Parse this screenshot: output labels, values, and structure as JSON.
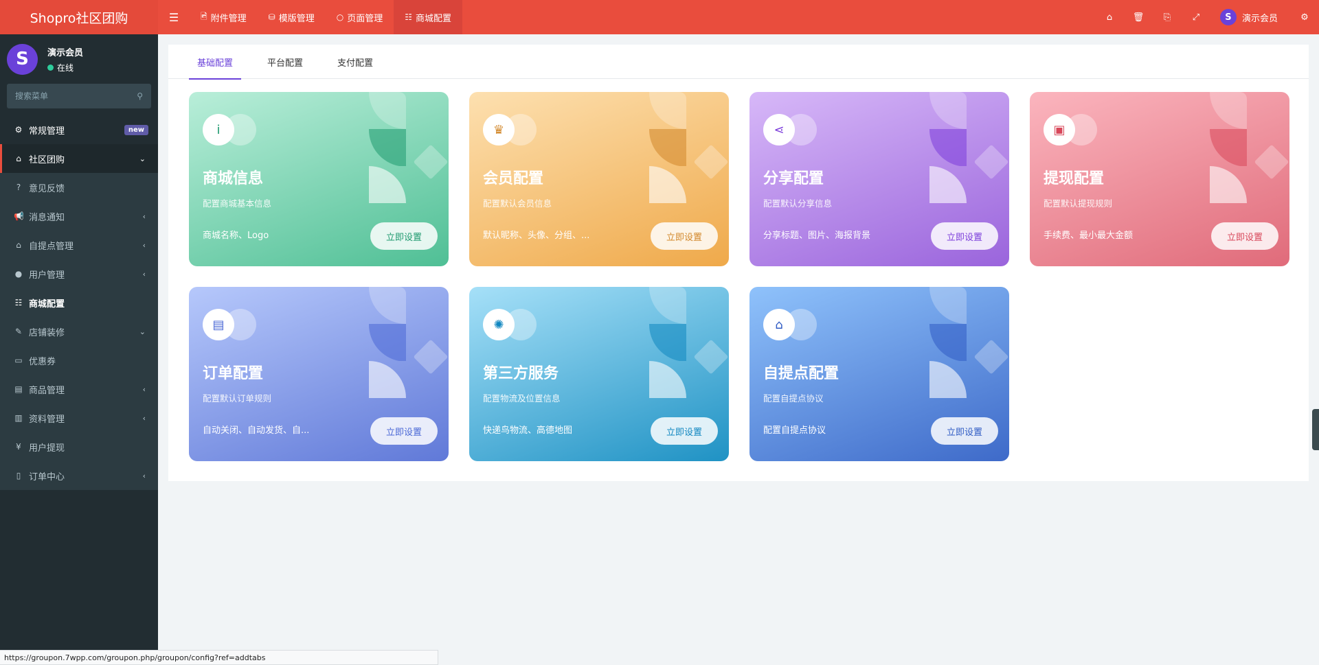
{
  "header": {
    "logo": "Shopro社区团购",
    "tabs": [
      {
        "label": "附件管理",
        "icon": "file-image-icon"
      },
      {
        "label": "模版管理",
        "icon": "cubes-icon"
      },
      {
        "label": "页面管理",
        "icon": "circle-icon"
      },
      {
        "label": "商城配置",
        "icon": "sliders-icon"
      }
    ],
    "right_icons": [
      "home-icon",
      "trash-icon",
      "translate-icon",
      "fullscreen-icon"
    ],
    "user_name": "演示会员",
    "user_avatar": "S"
  },
  "sidebar": {
    "user": {
      "name": "演示会员",
      "status": "在线",
      "avatar": "S"
    },
    "search_placeholder": "搜索菜单",
    "items": [
      {
        "label": "常规管理",
        "badge": "new"
      },
      {
        "label": "社区团购"
      },
      {
        "label": "意见反馈"
      },
      {
        "label": "消息通知"
      },
      {
        "label": "自提点管理"
      },
      {
        "label": "用户管理"
      },
      {
        "label": "商城配置"
      },
      {
        "label": "店铺装修"
      },
      {
        "label": "优惠券"
      },
      {
        "label": "商品管理"
      },
      {
        "label": "资料管理"
      },
      {
        "label": "用户提现"
      },
      {
        "label": "订单中心"
      }
    ]
  },
  "config": {
    "tabs": [
      "基础配置",
      "平台配置",
      "支付配置"
    ],
    "cards": [
      {
        "title": "商城信息",
        "subtitle": "配置商城基本信息",
        "desc": "商城名称、Logo",
        "button": "立即设置",
        "icon": "info-icon",
        "color_from": "#b9eed9",
        "color_to": "#4fbf95",
        "accent": "#1f9a6f"
      },
      {
        "title": "会员配置",
        "subtitle": "配置默认会员信息",
        "desc": "默认昵称、头像、分组、...",
        "button": "立即设置",
        "icon": "crown-icon",
        "color_from": "#fde0b0",
        "color_to": "#efa94a",
        "accent": "#d2872a"
      },
      {
        "title": "分享配置",
        "subtitle": "配置默认分享信息",
        "desc": "分享标题、图片、海报背景",
        "button": "立即设置",
        "icon": "share-icon",
        "color_from": "#d7b8f8",
        "color_to": "#9a64dc",
        "accent": "#7c3ddb"
      },
      {
        "title": "提现配置",
        "subtitle": "配置默认提现规则",
        "desc": "手续费、最小最大金额",
        "button": "立即设置",
        "icon": "wallet-icon",
        "color_from": "#fbb5be",
        "color_to": "#e06b7a",
        "accent": "#d8475a"
      },
      {
        "title": "订单配置",
        "subtitle": "配置默认订单规则",
        "desc": "自动关闭、自动发货、自...",
        "button": "立即设置",
        "icon": "clipboard-icon",
        "color_from": "#b6c8fb",
        "color_to": "#6079d8",
        "accent": "#4a68d6"
      },
      {
        "title": "第三方服务",
        "subtitle": "配置物流及位置信息",
        "desc": "快递鸟物流、高德地图",
        "button": "立即设置",
        "icon": "gear-flower-icon",
        "color_from": "#a6e0f8",
        "color_to": "#1f92c4",
        "accent": "#0f86c0"
      },
      {
        "title": "自提点配置",
        "subtitle": "配置自提点协议",
        "desc": "配置自提点协议",
        "button": "立即设置",
        "icon": "store-icon",
        "color_from": "#8fc2fb",
        "color_to": "#3e6ac9",
        "accent": "#2f5bc4"
      }
    ]
  },
  "statusbar": {
    "url": "https://groupon.7wpp.com/groupon.php/groupon/config?ref=addtabs"
  }
}
